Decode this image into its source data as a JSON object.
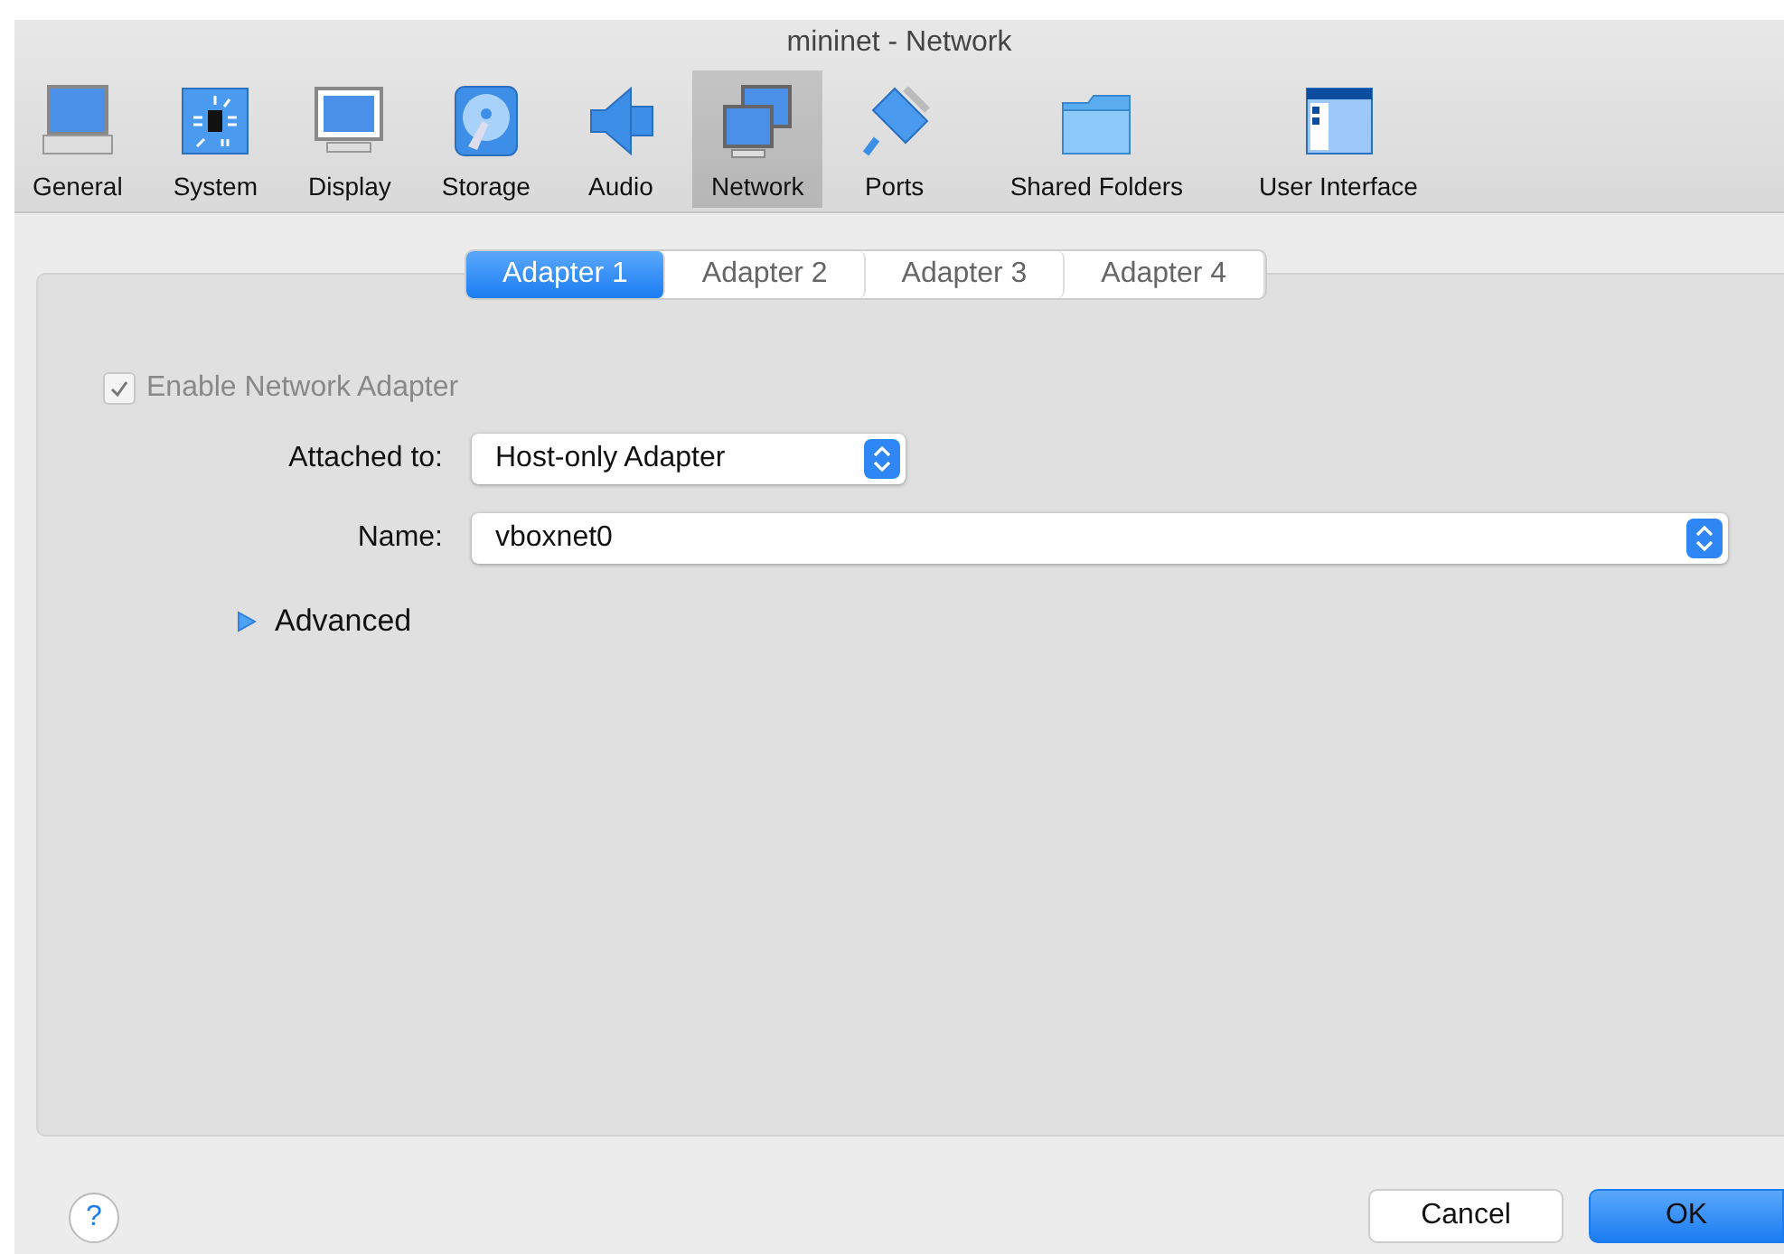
{
  "window": {
    "title": "mininet - Network"
  },
  "toolbar": [
    {
      "label": "General",
      "kind": "general",
      "selected": false
    },
    {
      "label": "System",
      "kind": "system",
      "selected": false
    },
    {
      "label": "Display",
      "kind": "display",
      "selected": false
    },
    {
      "label": "Storage",
      "kind": "storage",
      "selected": false
    },
    {
      "label": "Audio",
      "kind": "audio",
      "selected": false
    },
    {
      "label": "Network",
      "kind": "network",
      "selected": true
    },
    {
      "label": "Ports",
      "kind": "ports",
      "selected": false
    },
    {
      "label": "Shared Folders",
      "kind": "folder",
      "selected": false
    },
    {
      "label": "User Interface",
      "kind": "ui",
      "selected": false
    }
  ],
  "tabs": [
    {
      "label": "Adapter 1",
      "selected": true
    },
    {
      "label": "Adapter 2",
      "selected": false
    },
    {
      "label": "Adapter 3",
      "selected": false
    },
    {
      "label": "Adapter 4",
      "selected": false
    }
  ],
  "enable_adapter": {
    "label": "Enable Network Adapter",
    "checked": true,
    "disabled": true
  },
  "fields": [
    {
      "label": "Attached to:",
      "value": "Host-only Adapter",
      "wide": false
    },
    {
      "label": "Name:",
      "value": "vboxnet0",
      "wide": true
    }
  ],
  "advanced": {
    "label": "Advanced",
    "expanded": false
  },
  "help": {
    "label": "?"
  },
  "buttons": [
    {
      "label": "Cancel",
      "kind": "normal"
    },
    {
      "label": "OK",
      "kind": "default"
    }
  ]
}
